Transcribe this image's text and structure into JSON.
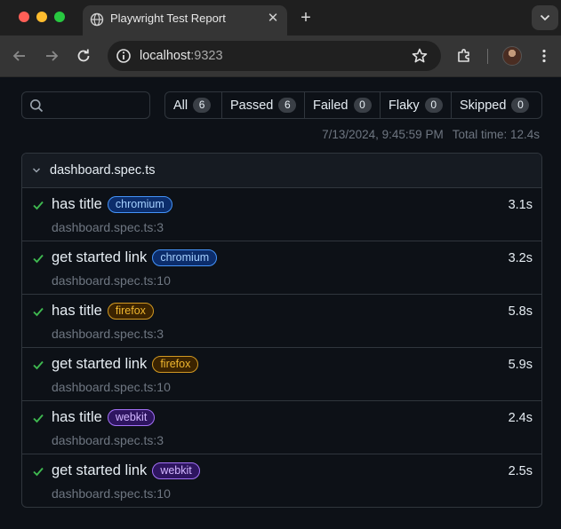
{
  "browser": {
    "tab_title": "Playwright Test Report",
    "new_tab_symbol": "+",
    "close_symbol": "✕",
    "url_host": "localhost",
    "url_port": ":9323"
  },
  "filters": [
    {
      "label": "All",
      "count": "6"
    },
    {
      "label": "Passed",
      "count": "6"
    },
    {
      "label": "Failed",
      "count": "0"
    },
    {
      "label": "Flaky",
      "count": "0"
    },
    {
      "label": "Skipped",
      "count": "0"
    }
  ],
  "meta": {
    "timestamp": "7/13/2024, 9:45:59 PM",
    "total_time": "Total time: 12.4s"
  },
  "suite": {
    "file": "dashboard.spec.ts",
    "tests": [
      {
        "title": "has title",
        "project": "chromium",
        "duration": "3.1s",
        "location": "dashboard.spec.ts:3"
      },
      {
        "title": "get started link",
        "project": "chromium",
        "duration": "3.2s",
        "location": "dashboard.spec.ts:10"
      },
      {
        "title": "has title",
        "project": "firefox",
        "duration": "5.8s",
        "location": "dashboard.spec.ts:3"
      },
      {
        "title": "get started link",
        "project": "firefox",
        "duration": "5.9s",
        "location": "dashboard.spec.ts:10"
      },
      {
        "title": "has title",
        "project": "webkit",
        "duration": "2.4s",
        "location": "dashboard.spec.ts:3"
      },
      {
        "title": "get started link",
        "project": "webkit",
        "duration": "2.5s",
        "location": "dashboard.spec.ts:10"
      }
    ]
  },
  "colors": {
    "pass_green": "#3fb950",
    "chromium": "#4493f8",
    "firefox": "#d29922",
    "webkit": "#a371f7"
  },
  "icons": {
    "back": "back-arrow-icon",
    "forward": "forward-arrow-icon",
    "reload": "reload-icon",
    "info": "site-info-icon",
    "bookmark": "star-icon",
    "extensions": "puzzle-icon",
    "menu": "kebab-menu-icon",
    "search": "search-icon",
    "pass": "checkmark-icon",
    "collapse": "chevron-down-icon"
  }
}
